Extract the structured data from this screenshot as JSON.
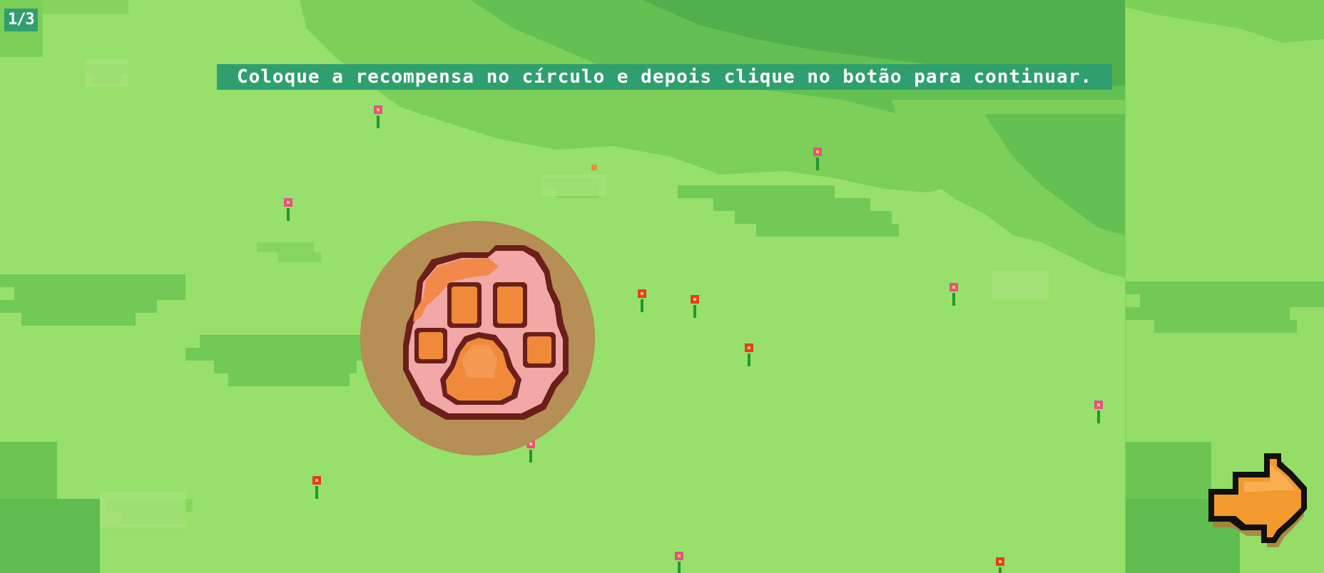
{
  "hud": {
    "progress": "1/3"
  },
  "tutorial": {
    "instruction": "Coloque a recompensa no círculo e depois clique no botão para continuar."
  },
  "colors": {
    "grass_light": "#97e06b",
    "grass_mid": "#79cc52",
    "grass_dark": "#4fb04d",
    "banner": "#2f9f6f",
    "target_circle": "#b58f55",
    "paw_pad": "#f08a3a",
    "paw_base": "#f1a8a6",
    "paw_outline": "#6b1f1a",
    "arrow": "#f29a2e"
  },
  "icons": {
    "reward": "paw-print-icon",
    "next": "arrow-right-icon",
    "flower": "flower-icon"
  }
}
